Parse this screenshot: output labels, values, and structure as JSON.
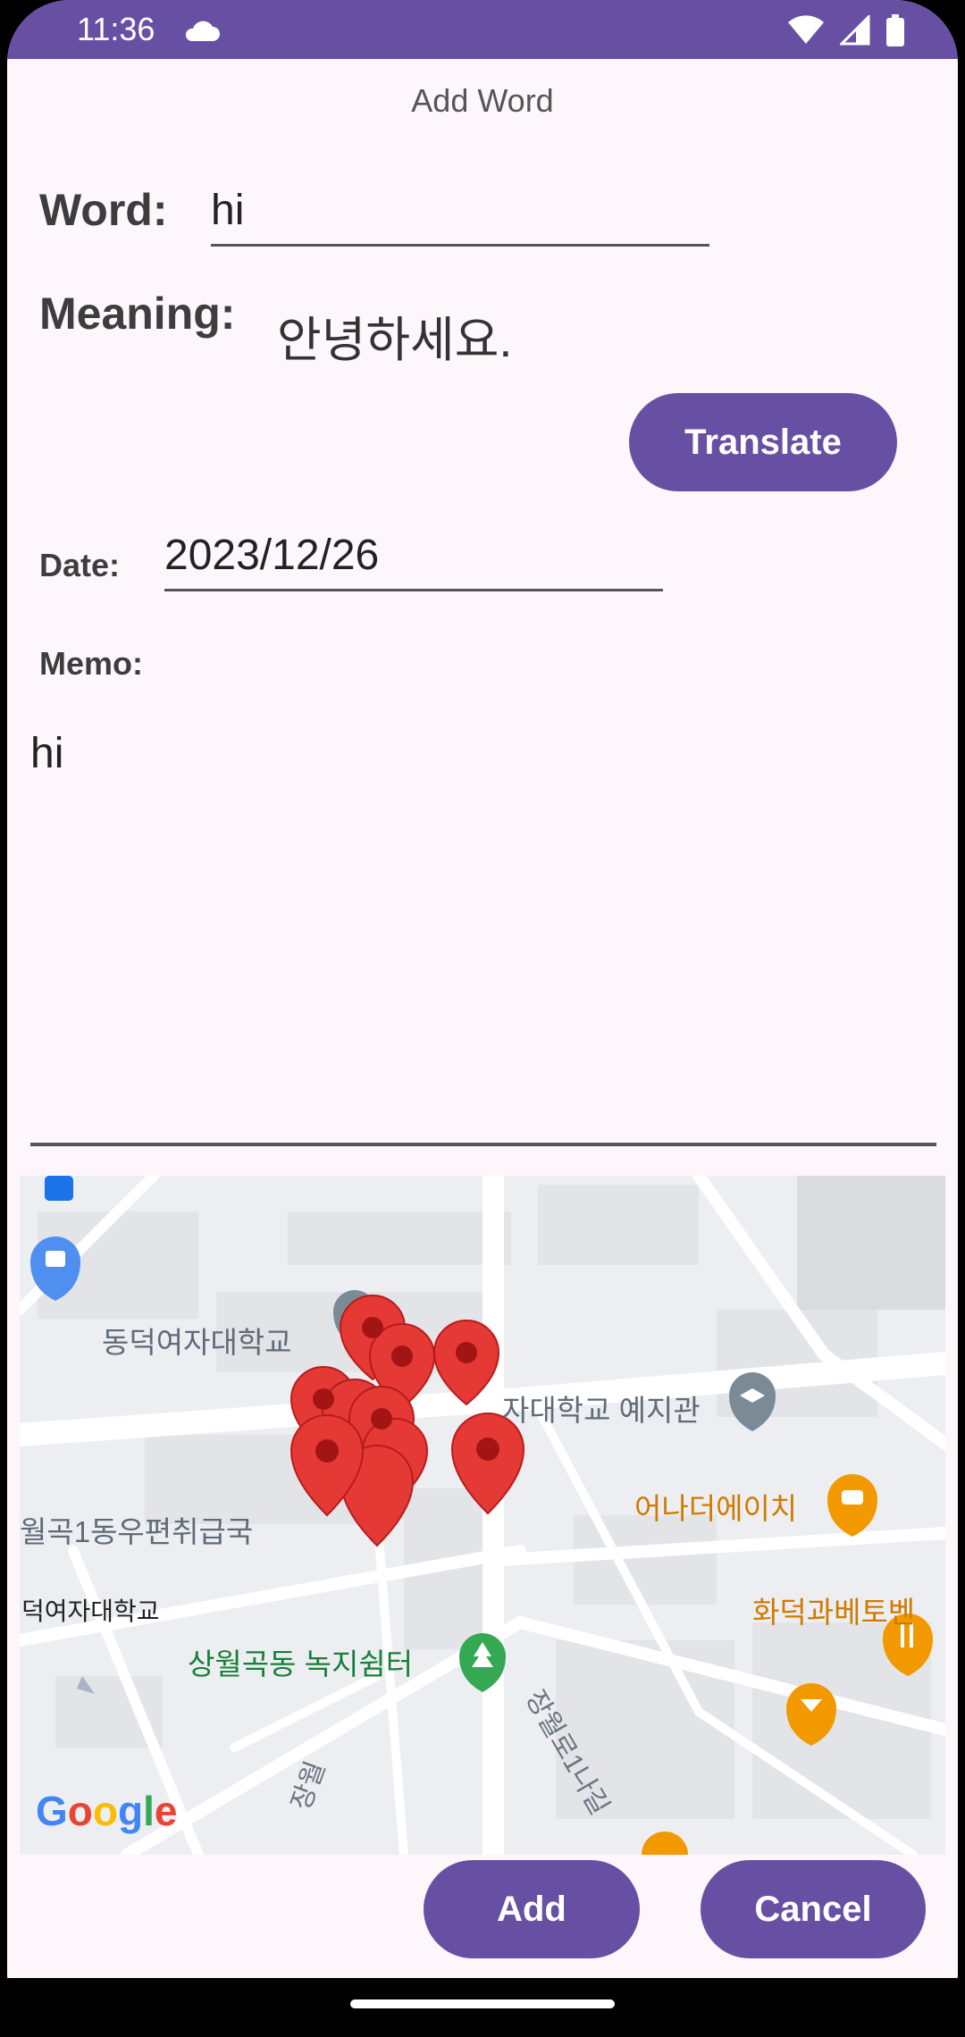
{
  "status_bar": {
    "time": "11:36",
    "icons": [
      "cloud-icon",
      "wifi-icon",
      "signal-icon",
      "battery-icon"
    ]
  },
  "topbar": {
    "title": "Add Word"
  },
  "form": {
    "word_label": "Word:",
    "word_value": "hi",
    "meaning_label": "Meaning:",
    "meaning_value": "안녕하세요.",
    "translate_button": "Translate",
    "date_label": "Date:",
    "date_value": "2023/12/26",
    "memo_label": "Memo:",
    "memo_value": "hi"
  },
  "map": {
    "labels": {
      "donduk_univ": "동덕여자대학교",
      "yeji_hall": "자대학교 예지관",
      "post_office": "월곡1동우편취급국",
      "donduk_univ_2": "덕여자대학교",
      "green_park": "상월곡동 녹지쉼터",
      "anada": "어나더에이치",
      "hwadeok": "화덕과베토벤",
      "road_1": "장월로1나길",
      "road_2": "장월"
    },
    "logo": "Google",
    "accent_colors": {
      "marker": "#e53935",
      "poi_orange": "#f29900",
      "poi_green": "#34a853",
      "poi_gray": "#7b8a97"
    }
  },
  "actions": {
    "add_button": "Add",
    "cancel_button": "Cancel"
  },
  "colors": {
    "primary": "#6750a4",
    "background": "#fdf7fc"
  }
}
